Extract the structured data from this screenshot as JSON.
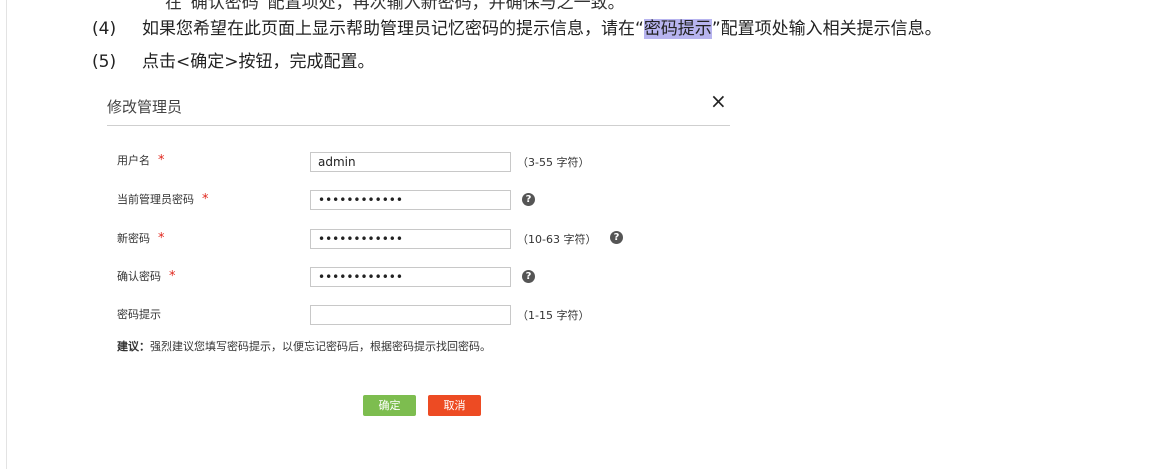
{
  "doc": {
    "clipped_line": "在“确认密码”配置项处，再次输入新密码，并确保与之一致。",
    "step4": {
      "num": "(4)",
      "text_before": "如果您希望在此页面上显示帮助管理员记忆密码的提示信息，请在“",
      "highlight": "密码提示",
      "text_after": "”配置项处输入相关提示信息。"
    },
    "step5": {
      "num": "(5)",
      "text": "点击<确定>按钮，完成配置。"
    }
  },
  "dialog": {
    "title": "修改管理员",
    "close_glyph": "×",
    "required_mark": "*",
    "help_glyph": "?",
    "fields": {
      "username": {
        "label": "用户名",
        "value": "admin",
        "hint": "（3-55 字符）"
      },
      "current_password": {
        "label": "当前管理员密码",
        "value": "••••••••••••"
      },
      "new_password": {
        "label": "新密码",
        "value": "••••••••••••",
        "hint": "（10-63 字符）"
      },
      "confirm_password": {
        "label": "确认密码",
        "value": "••••••••••••"
      },
      "password_hint": {
        "label": "密码提示",
        "value": "",
        "hint": "（1-15 字符）"
      }
    },
    "suggestion": {
      "prefix": "建议：",
      "text": "强烈建议您填写密码提示，以便忘记密码后，根据密码提示找回密码。"
    },
    "buttons": {
      "ok": "确定",
      "cancel": "取消"
    },
    "colors": {
      "ok": "#7dbd4f",
      "cancel": "#ed4b23",
      "required": "#e0261c",
      "highlight": "#b7b4ef"
    }
  }
}
